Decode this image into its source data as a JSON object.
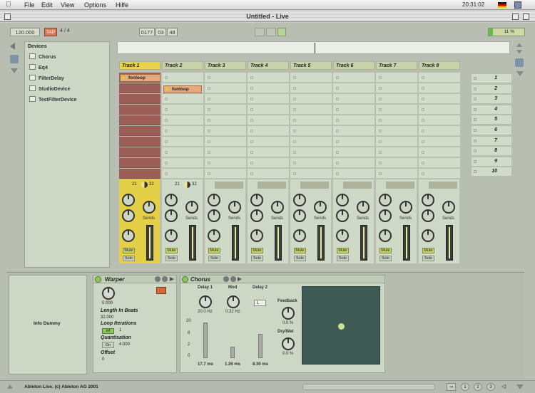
{
  "menubar": {
    "items": [
      "File",
      "Edit",
      "View",
      "Options",
      "Hilfe"
    ],
    "clock": "20:31:02"
  },
  "window": {
    "title": "Untitled - Live"
  },
  "transport": {
    "tempo": "120.000",
    "tap": "TAP",
    "sig_num": "4",
    "sig_den": "4",
    "pos_bar": "0177",
    "pos_beat": "03",
    "pos_sixteenth": "48",
    "cpu": "11 %"
  },
  "browser": {
    "header": "Devices",
    "items": [
      "Chorus",
      "Eq4",
      "FilterDelay",
      "StudioDevice",
      "TestFilterDevice"
    ]
  },
  "tracks": [
    {
      "name": "Track 1",
      "clip": "fonloop",
      "clip_slot": 0
    },
    {
      "name": "Track 2",
      "clip": "fonloop",
      "clip_slot": 1
    },
    {
      "name": "Track 3"
    },
    {
      "name": "Track 4"
    },
    {
      "name": "Track 5"
    },
    {
      "name": "Track 6"
    },
    {
      "name": "Track 7"
    },
    {
      "name": "Track 8"
    }
  ],
  "track1_io": {
    "a": "21",
    "b": "32"
  },
  "track2_io": {
    "a": "21",
    "b": "32"
  },
  "mixer": {
    "sends": "Sends",
    "mute": "Mute",
    "solo": "Solo"
  },
  "scenes": [
    "1",
    "2",
    "3",
    "4",
    "5",
    "6",
    "7",
    "8",
    "9",
    "10"
  ],
  "info": {
    "text": "Info Dummy"
  },
  "warper": {
    "title": "Warper",
    "value": "0.000",
    "length_label": "Length In Beats",
    "length_value": "32.000",
    "loop_label": "Loop Iterations",
    "loop_toggle": "inf",
    "loop_value": "1",
    "quant_label": "Quantisation",
    "quant_toggle": "On",
    "quant_value": "4.000",
    "offset_label": "Offset",
    "offset_value": "0"
  },
  "chorus": {
    "title": "Chorus",
    "delay1_label": "Delay 1",
    "delay1_freq": "20.0 Hz",
    "mod_label": "Mod",
    "mod_freq": "0.32 Hz",
    "delay2_label": "Delay 2",
    "delay2_mode": "L",
    "feedback_label": "Feedback",
    "feedback_value": "0.0 %",
    "drywet_label": "Dry/Wet",
    "drywet_value": "0.0 %",
    "scale": [
      "20",
      "8",
      "2",
      "0"
    ],
    "delay1_ms": "17.7 ms",
    "mod_ms": "1.26 ms",
    "delay2_ms": "8.30 ms"
  },
  "status": {
    "text": "Ableton Live. (c) Ableton AG 2001",
    "pages": [
      "1",
      "2",
      "3"
    ]
  }
}
